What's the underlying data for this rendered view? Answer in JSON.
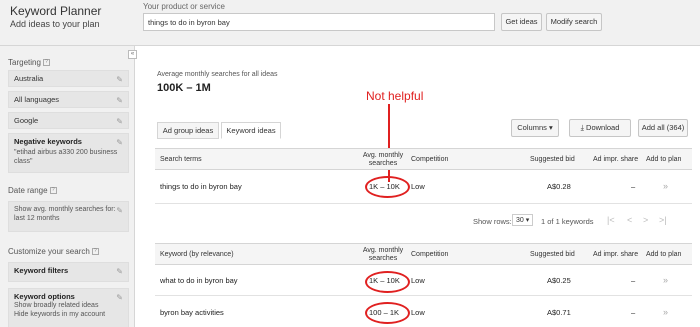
{
  "header": {
    "title": "Keyword Planner",
    "subtitle": "Add ideas to your plan",
    "product_label": "Your product or service",
    "product_value": "things to do in byron bay",
    "get_ideas": "Get ideas",
    "modify_search": "Modify search"
  },
  "sidebar": {
    "collapse": "«",
    "targeting_label": "Targeting",
    "targeting_items": [
      "Australia",
      "All languages",
      "Google"
    ],
    "negative_title": "Negative keywords",
    "negative_value": "\"etihad airbus a330 200 business class\"",
    "date_range_label": "Date range",
    "date_range_value": "Show avg. monthly searches for: last 12 months",
    "customize_label": "Customize your search",
    "keyword_filters": "Keyword filters",
    "keyword_options_title": "Keyword options",
    "keyword_options_line1": "Show broadly related ideas",
    "keyword_options_line2": "Hide keywords in my account"
  },
  "main": {
    "avg_label": "Average monthly searches for all ideas",
    "avg_value": "100K – 1M",
    "annotation": "Not helpful",
    "tabs": [
      "Ad group ideas",
      "Keyword ideas"
    ],
    "columns_btn": "Columns",
    "download_btn": "Download",
    "add_all_btn": "Add all (364)",
    "table1": {
      "headers": [
        "Search terms",
        "Avg. monthly searches",
        "Competition",
        "Suggested bid",
        "Ad impr. share",
        "Add to plan"
      ],
      "rows": [
        {
          "term": "things to do in byron bay",
          "searches": "1K – 10K",
          "competition": "Low",
          "bid": "A$0.28",
          "share": "–",
          "add": "»"
        }
      ]
    },
    "pager": {
      "show_rows": "Show rows:",
      "rows_value": "30",
      "range": "1 of 1 keywords"
    },
    "table2": {
      "headers": [
        "Keyword (by relevance)",
        "Avg. monthly searches",
        "Competition",
        "Suggested bid",
        "Ad impr. share",
        "Add to plan"
      ],
      "rows": [
        {
          "term": "what to do in byron bay",
          "searches": "1K – 10K",
          "competition": "Low",
          "bid": "A$0.25",
          "share": "–",
          "add": "»"
        },
        {
          "term": "byron bay activities",
          "searches": "100 – 1K",
          "competition": "Low",
          "bid": "A$0.71",
          "share": "–",
          "add": "»"
        }
      ]
    }
  }
}
